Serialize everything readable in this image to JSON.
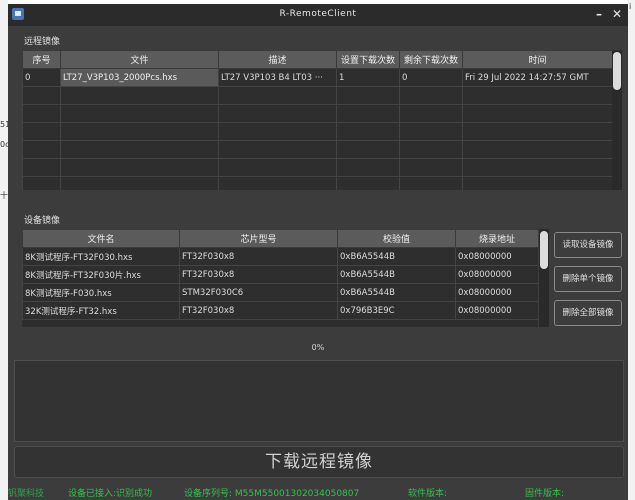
{
  "window": {
    "title": "R-RemoteClient"
  },
  "remote_section": {
    "title": "远程镜像",
    "columns": [
      "序号",
      "文件",
      "描述",
      "设置下载次数",
      "剩余下载次数",
      "时间"
    ],
    "rows": [
      [
        "0",
        "LT27_V3P103_2000Pcs.hxs",
        "LT27 V3P103 B4 LT03 ···",
        "1",
        "0",
        "Fri 29 Jul 2022 14:27:57 GMT"
      ]
    ]
  },
  "device_section": {
    "title": "设备镜像",
    "columns": [
      "文件名",
      "芯片型号",
      "校验值",
      "烧录地址"
    ],
    "rows": [
      [
        "8K测试程序-FT32F030.hxs",
        "FT32F030x8",
        "0xB6A5544B",
        "0x08000000"
      ],
      [
        "8K测试程序-FT32F030片.hxs",
        "FT32F030x8",
        "0xB6A5544B",
        "0x08000000"
      ],
      [
        "8K测试程序-F030.hxs",
        "STM32F030C6",
        "0xB6A5544B",
        "0x08000000"
      ],
      [
        "32K测试程序-FT32.hxs",
        "FT32F030x8",
        "0x796B3E9C",
        "0x08000000"
      ]
    ],
    "buttons": {
      "read": "读取设备镜像",
      "delete_one": "删除单个镜像",
      "delete_all": "删除全部镜像"
    }
  },
  "progress": {
    "value": 0,
    "label": "0%"
  },
  "download_button": "下载远程镜像",
  "statusbar": {
    "company": "钒聚科技",
    "device_status": "设备已接入:识别成功",
    "serial": "设备序列号: M55M55001302034050807",
    "software_version": "软件版本:",
    "firmware_version": "固件版本:"
  },
  "colors": {
    "window_bg": "#3c3c3c",
    "header_bg": "#5b5b5b",
    "status_green": "#33c24a"
  }
}
